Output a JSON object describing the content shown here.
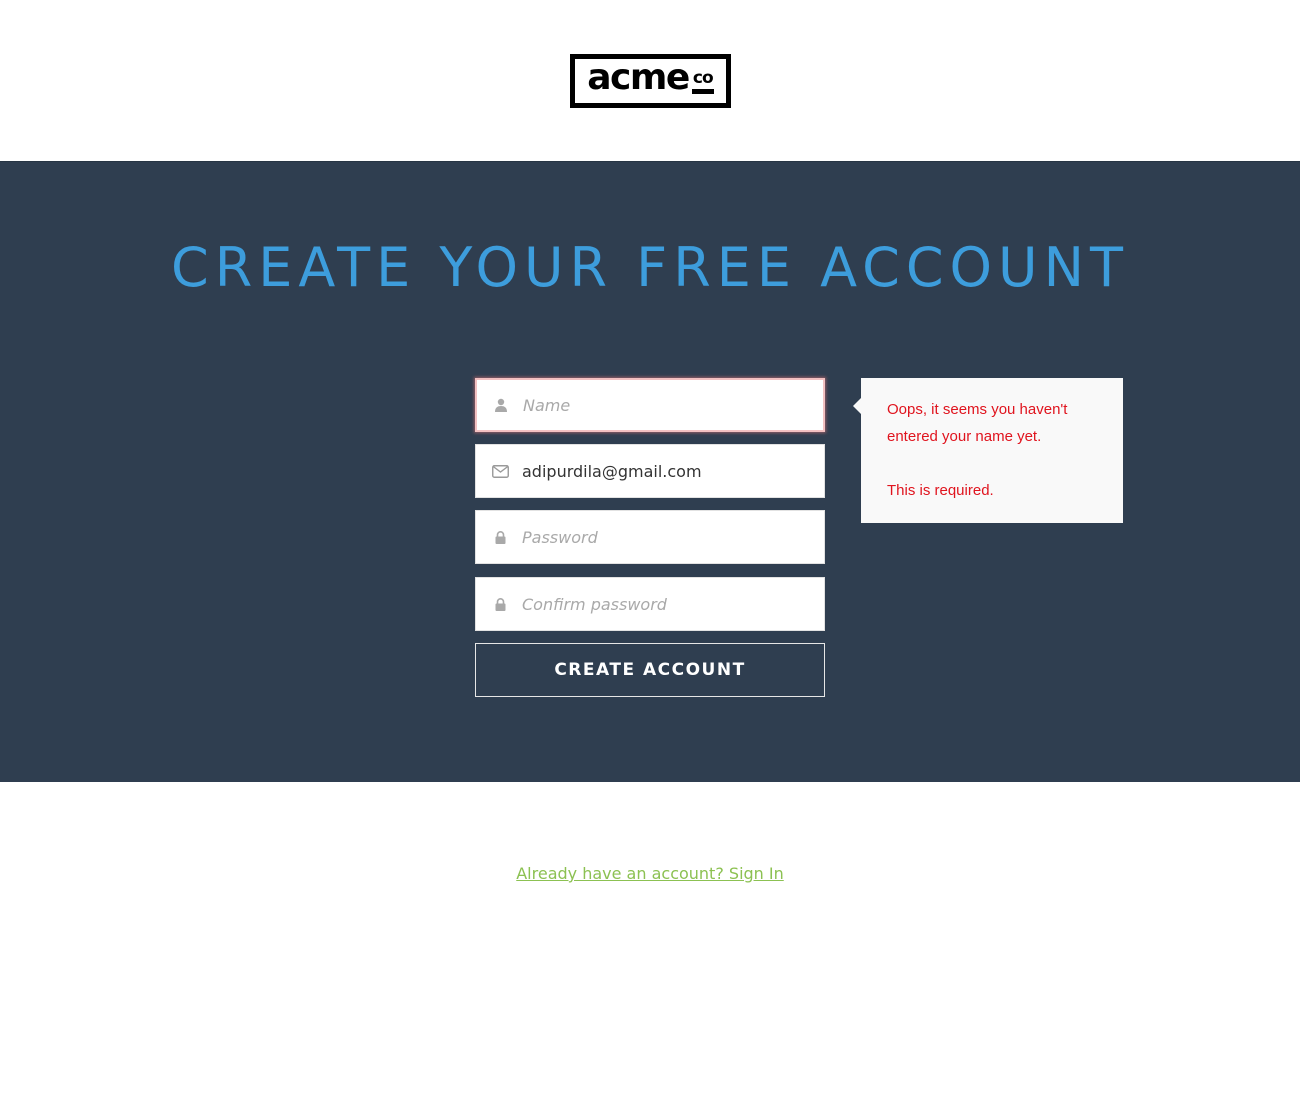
{
  "brand": {
    "logo_text": "acme",
    "logo_suffix": "co"
  },
  "hero": {
    "title": "CREATE YOUR FREE ACCOUNT"
  },
  "form": {
    "name": {
      "value": "",
      "placeholder": "Name"
    },
    "email": {
      "value": "adipurdila@gmail.com",
      "placeholder": ""
    },
    "password": {
      "value": "",
      "placeholder": "Password"
    },
    "confirm": {
      "value": "",
      "placeholder": "Confirm password"
    },
    "submit_label": "CREATE ACCOUNT"
  },
  "validation": {
    "message": "Oops, it seems you haven't entered your name yet.",
    "required": "This is required."
  },
  "footer": {
    "signin_link": "Already have an account? Sign In"
  },
  "colors": {
    "hero_bg": "#2f3e50",
    "title": "#3d9ddc",
    "error_text": "#e0141e",
    "link": "#8cc152"
  },
  "icons": {
    "name": "user-icon",
    "email": "envelope-icon",
    "password": "lock-icon",
    "confirm": "lock-icon"
  }
}
